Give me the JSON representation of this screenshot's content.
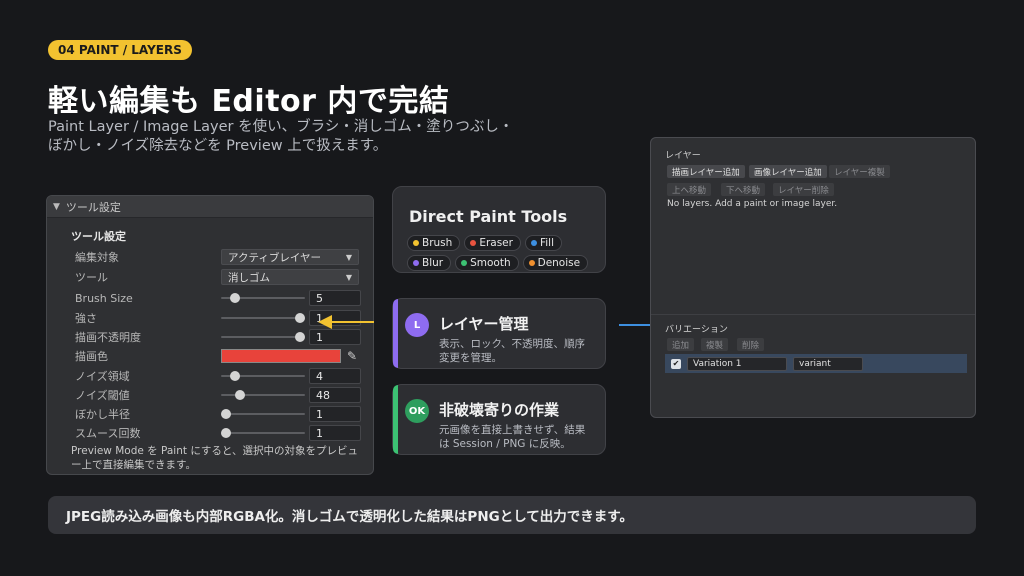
{
  "header": {
    "badge": "04  PAINT / LAYERS",
    "title": "軽い編集も Editor 内で完結",
    "subtitle": "Paint Layer / Image Layer を使い、ブラシ・消しゴム・塗りつぶし・ぼかし・ノイズ除去などを Preview 上で扱えます。"
  },
  "tool_panel": {
    "header": "ツール設定",
    "section": "ツール設定",
    "target_label": "編集対象",
    "target_value": "アクティブレイヤー",
    "tool_label": "ツール",
    "tool_value": "消しゴム",
    "brush_size_label": "Brush Size",
    "brush_size": "5",
    "brush_size_fraction": 0.12,
    "strength_label": "強さ",
    "strength": "1",
    "strength_fraction": 1.0,
    "opacity_label": "描画不透明度",
    "opacity": "1",
    "opacity_fraction": 1.0,
    "color_label": "描画色",
    "color": "#e8433b",
    "noise_area_label": "ノイズ領域",
    "noise_area": "4",
    "noise_area_fraction": 0.12,
    "noise_threshold_label": "ノイズ閾値",
    "noise_threshold": "48",
    "noise_threshold_fraction": 0.19,
    "blur_radius_label": "ぼかし半径",
    "blur_radius": "1",
    "blur_radius_fraction": 0.0,
    "smooth_label": "スムース回数",
    "smooth": "1",
    "smooth_fraction": 0.0,
    "footer": "Preview Mode を Paint にすると、選択中の対象をプレビュー上で直接編集できます。"
  },
  "direct_paint": {
    "title": "Direct Paint Tools",
    "chips": [
      {
        "label": "Brush",
        "color": "#f2c230"
      },
      {
        "label": "Eraser",
        "color": "#e8533f"
      },
      {
        "label": "Fill",
        "color": "#3d8fe0"
      },
      {
        "label": "Blur",
        "color": "#8e6cf0"
      },
      {
        "label": "Smooth",
        "color": "#3cc173"
      },
      {
        "label": "Denoise",
        "color": "#f0902f"
      }
    ]
  },
  "features": [
    {
      "icon": "L",
      "title": "レイヤー管理",
      "desc": "表示、ロック、不透明度、順序変更を管理。",
      "color": "#8e6cf0"
    },
    {
      "icon": "OK",
      "title": "非破壊寄りの作業",
      "desc": "元画像を直接上書きせず、結果は Session / PNG に反映。",
      "color": "#3cc173"
    }
  ],
  "layer_panel": {
    "title": "レイヤー",
    "add_paint": "描画レイヤー追加",
    "add_image": "画像レイヤー追加",
    "duplicate": "レイヤー複製",
    "move_up": "上へ移動",
    "move_down": "下へ移動",
    "delete": "レイヤー削除",
    "empty_message": "No layers. Add a paint or image layer.",
    "variation_title": "バリエーション",
    "var_add": "追加",
    "var_dup": "複製",
    "var_del": "削除",
    "variation_name": "Variation 1",
    "variation_id": "variant"
  },
  "footer_note": "JPEG読み込み画像も内部RGBA化。消しゴムで透明化した結果はPNGとして出力できます。",
  "colors": {
    "accent_yellow": "#f2c230",
    "accent_blue": "#3d8fe0",
    "bg": "#17181b"
  }
}
